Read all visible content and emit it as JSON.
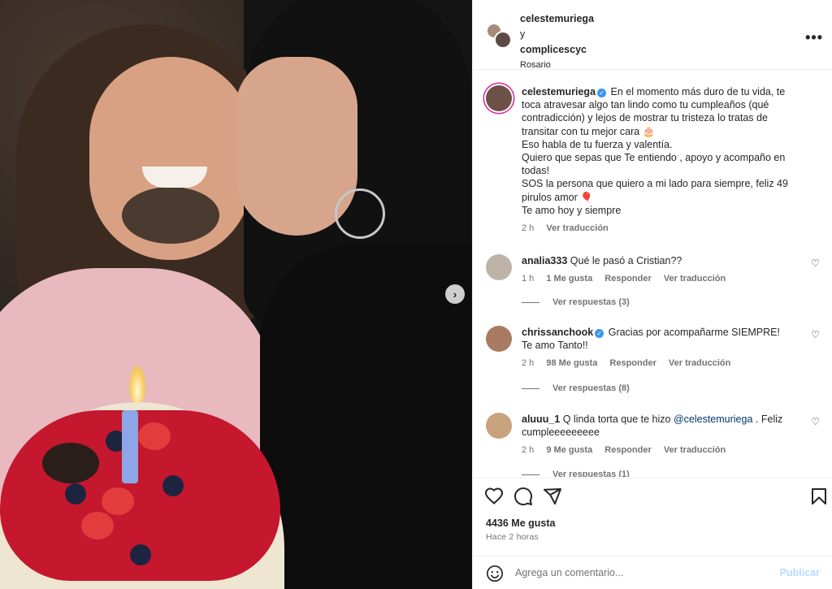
{
  "post": {
    "header": {
      "user1": "celestemuriega",
      "connector": "y",
      "user2": "complicescyc",
      "location": "Rosario"
    },
    "caption": {
      "username": "celestemuriega",
      "lines": [
        "En el momento más duro de tu vida, te",
        "toca atravesar algo tan lindo como tu cumpleaños (qué",
        "contradicción) y lejos de mostrar tu tristeza lo tratas de",
        "transitar con tu mejor cara 🎂",
        "Eso habla de tu fuerza y valentía.",
        "Quiero que sepas que Te entiendo , apoyo y acompaño en",
        "todas!",
        "SOS la persona que quiero a mi lado para siempre, feliz 49",
        "pirulos amor 🎈",
        "Te amo hoy y siempre"
      ],
      "time": "2 h",
      "translate": "Ver traducción"
    },
    "comments": [
      {
        "username": "analia333",
        "text": "Qué le pasó a Cristian??",
        "time": "1 h",
        "likes": "1 Me gusta",
        "reply": "Responder",
        "translate": "Ver traducción",
        "replies": "Ver respuestas (3)"
      },
      {
        "username": "chrissanchook",
        "text_lines": [
          "Gracias por acompañarme SIEMPRE!",
          "Te amo Tanto!!"
        ],
        "time": "2 h",
        "likes": "98 Me gusta",
        "reply": "Responder",
        "translate": "Ver traducción",
        "replies": "Ver respuestas (8)"
      },
      {
        "username": "aluuu_1",
        "text_before": "Q linda torta que te hizo",
        "mention": "@celestemuriega",
        "text_after": ". Feliz",
        "text_line2": "cumpleeeeeeeee",
        "time": "2 h",
        "likes": "9 Me gusta",
        "reply": "Responder",
        "translate": "Ver traducción",
        "replies": "Ver respuestas (1)"
      }
    ],
    "likes": "4436 Me gusta",
    "posted": "Hace 2 horas",
    "add_comment_placeholder": "Agrega un comentario...",
    "publish": "Publicar"
  },
  "icons": {
    "heart": "heart-icon",
    "comment": "comment-icon",
    "share": "share-icon",
    "save": "bookmark-icon",
    "more": "more-options-icon",
    "emoji": "emoji-icon",
    "next": "chevron-right-icon"
  },
  "colors": {
    "verified": "#3897f0",
    "link": "#00376b",
    "muted": "#737373",
    "publish_disabled": "#b3dbff"
  }
}
